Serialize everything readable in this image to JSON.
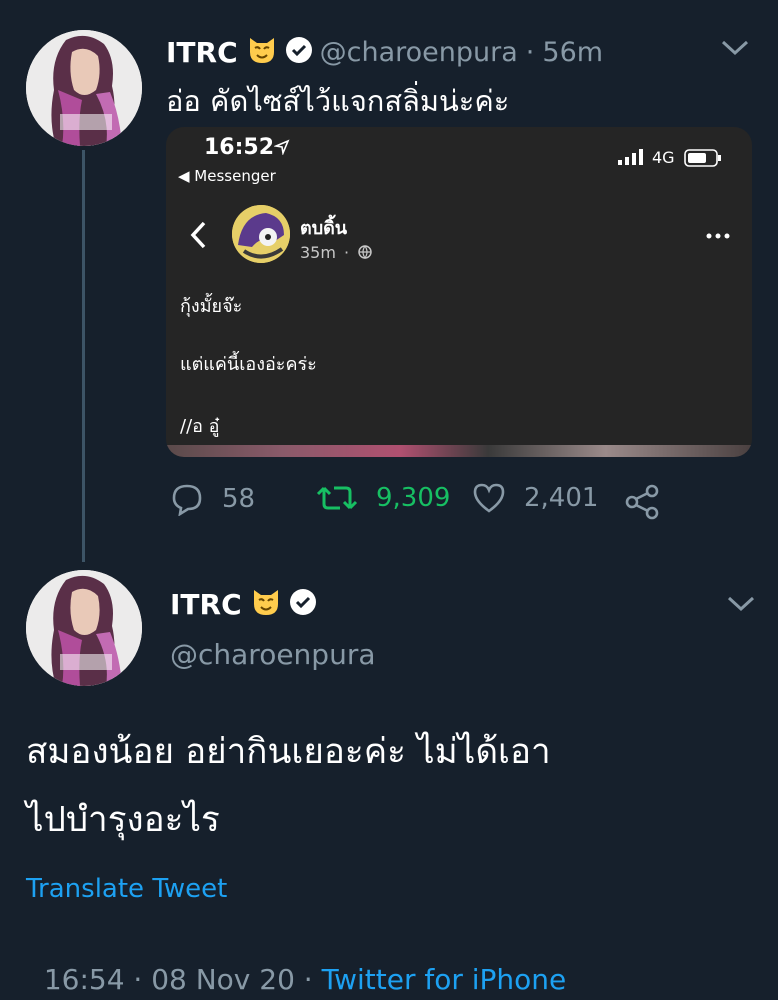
{
  "tweet1": {
    "display_name": "ITRC",
    "handle": "@charoenpura",
    "separator": "·",
    "time": "56m",
    "text": "อ่อ คัดไซส์ไว้แจกสลิ่มน่ะค่ะ",
    "replies": "58",
    "retweets": "9,309",
    "likes": "2,401"
  },
  "embed": {
    "status_time": "16:52",
    "back_label": "◀ Messenger",
    "network": "4G",
    "chat_name": "ตบดิ้น",
    "chat_time": "35m",
    "messages": [
      "กุ้งมั้ยจ๊ะ",
      "แต่แค่นี้เองอ่ะคร่ะ",
      "//อ อู๋"
    ]
  },
  "tweet2": {
    "display_name": "ITRC",
    "handle": "@charoenpura",
    "text_line1": "สมองน้อย อย่ากินเยอะค่ะ ไม่ได้เอา",
    "text_line2": "ไปบำรุงอะไร",
    "translate": "Translate Tweet",
    "timestamp": "16:54 · 08 Nov 20 · ",
    "source": "Twitter for iPhone"
  },
  "colors": {
    "background": "#16202c",
    "accent_blue": "#1da1f2",
    "retweet_green": "#17bf63",
    "muted": "#8899a6"
  },
  "icons": [
    "cat-emoji-icon",
    "verified-icon",
    "chevron-down-icon",
    "reply-icon",
    "retweet-icon",
    "like-icon",
    "share-icon",
    "location-arrow-icon",
    "signal-icon",
    "battery-icon",
    "back-chevron-icon",
    "more-icon",
    "globe-icon"
  ]
}
